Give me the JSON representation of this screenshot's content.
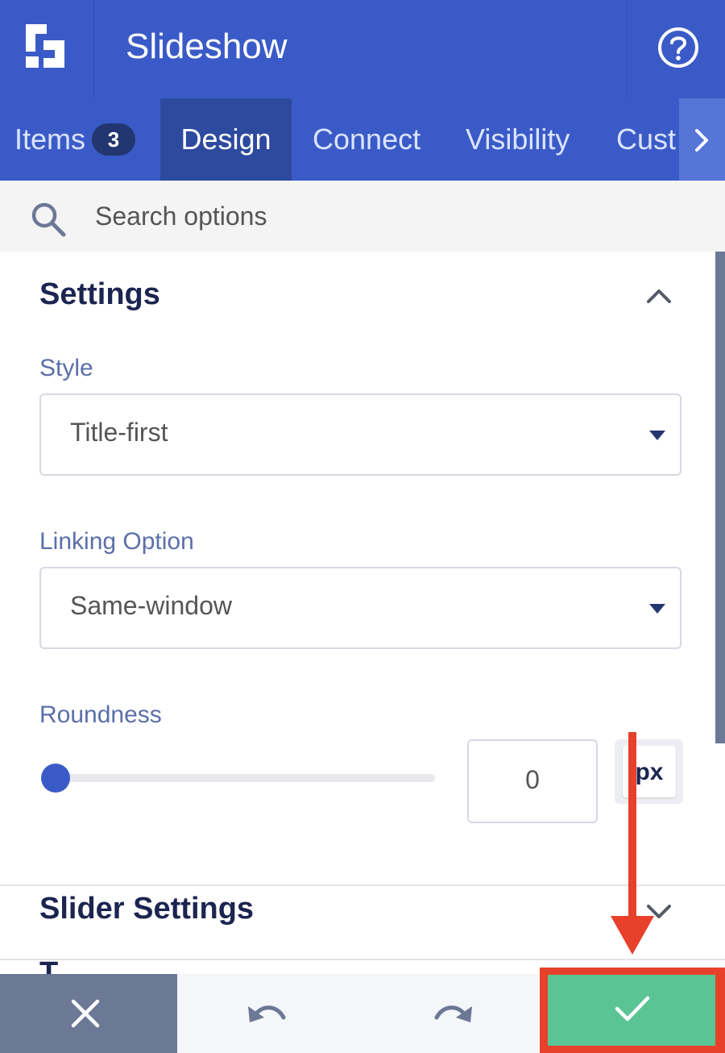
{
  "header": {
    "title": "Slideshow",
    "logo_icon": "builder-logo-icon",
    "help_icon": "help-circle-icon"
  },
  "tabs": [
    {
      "label": "Items",
      "badge": "3"
    },
    {
      "label": "Design",
      "active": true
    },
    {
      "label": "Connect"
    },
    {
      "label": "Visibility"
    },
    {
      "label": "Cust"
    }
  ],
  "search": {
    "placeholder": "Search options"
  },
  "settings": {
    "title": "Settings",
    "style": {
      "label": "Style",
      "value": "Title-first"
    },
    "linking": {
      "label": "Linking Option",
      "value": "Same-window"
    },
    "roundness": {
      "label": "Roundness",
      "value": "0",
      "unit": "px",
      "slider_fraction": 0
    }
  },
  "slider_settings": {
    "title": "Slider Settings"
  },
  "next_section": {
    "title_partial": "T"
  },
  "footer": {
    "cancel_icon": "close-icon",
    "undo_icon": "undo-icon",
    "redo_icon": "redo-icon",
    "save_icon": "check-icon"
  },
  "colors": {
    "header": "#3a5bc7",
    "active_tab": "#2d4a9f",
    "save": "#5bc494",
    "highlight": "#e8412b",
    "cancel": "#6b7896"
  }
}
